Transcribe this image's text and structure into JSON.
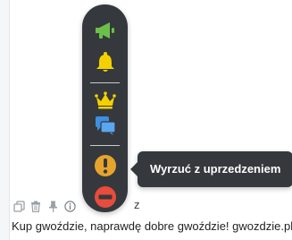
{
  "toolbar": {
    "items": [
      {
        "icon": "megaphone-icon",
        "color": "#6cc04a"
      },
      {
        "icon": "bell-icon",
        "color": "#f5d000"
      },
      {
        "icon": "crown-icon",
        "color": "#f5d000"
      },
      {
        "icon": "chat-bubbles-icon",
        "color": "#3d8fe0"
      },
      {
        "icon": "warning-circle-icon",
        "color": "#e6a42c"
      },
      {
        "icon": "ban-circle-icon",
        "color": "#e74c3c"
      }
    ]
  },
  "tooltip": {
    "text": "Wyrzuć z uprzedzeniem"
  },
  "message": {
    "actions": [
      "copy-icon",
      "trash-icon",
      "pin-icon",
      "info-icon"
    ],
    "partial_text": "z",
    "text": "Kup gwoździe, naprawdę dobre gwoździe! gwozdzie.pl"
  }
}
